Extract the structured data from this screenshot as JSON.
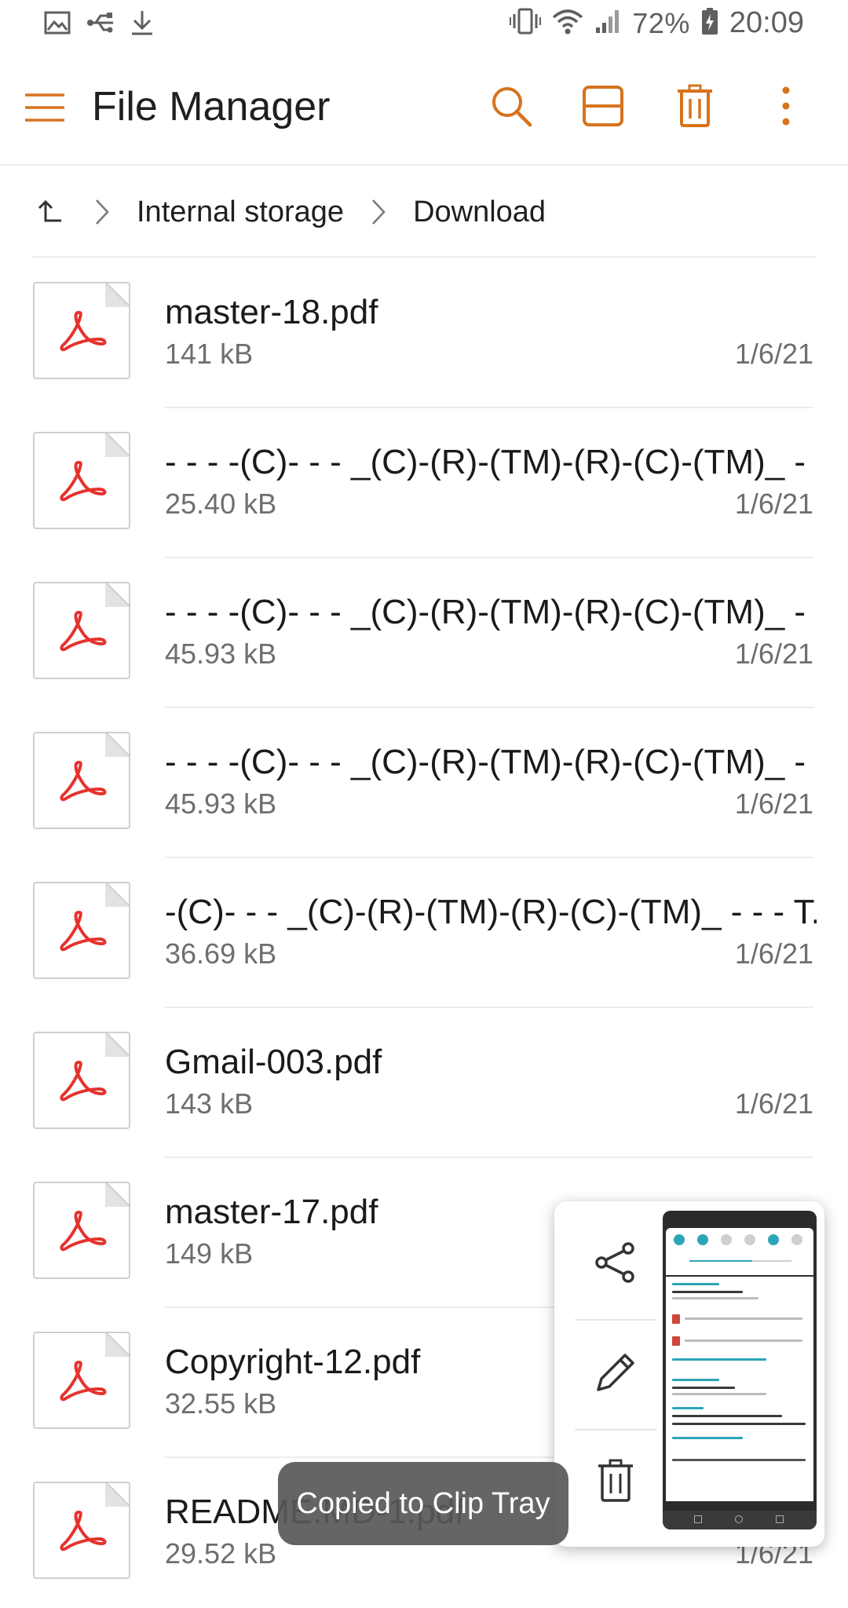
{
  "status_bar": {
    "left_icons": [
      "image-icon",
      "usb-icon",
      "download-icon"
    ],
    "right_icons": [
      "vibrate-icon",
      "wifi-icon",
      "signal-icon",
      "battery-charging-icon"
    ],
    "battery": "72%",
    "time": "20:09"
  },
  "app_bar": {
    "title": "File Manager",
    "actions": [
      "search-icon",
      "layout-icon",
      "trash-icon",
      "more-vert-icon"
    ],
    "accent_color": "#d6731d"
  },
  "breadcrumb": {
    "items": [
      "Internal storage",
      "Download"
    ]
  },
  "files": [
    {
      "name": "master-18.pdf",
      "size": "141 kB",
      "date": "1/6/21"
    },
    {
      "name": "- - - -(C)- - - _(C)-(R)-(TM)-(R)-(C)-(TM)_ - ..",
      "size": "25.40 kB",
      "date": "1/6/21"
    },
    {
      "name": "- - - -(C)- - - _(C)-(R)-(TM)-(R)-(C)-(TM)_ - ..",
      "size": "45.93 kB",
      "date": "1/6/21"
    },
    {
      "name": "- - - -(C)- - - _(C)-(R)-(TM)-(R)-(C)-(TM)_ - ..",
      "size": "45.93 kB",
      "date": "1/6/21"
    },
    {
      "name": "-(C)- - - _(C)-(R)-(TM)-(R)-(C)-(TM)_ - - - T..",
      "size": "36.69 kB",
      "date": "1/6/21"
    },
    {
      "name": "Gmail-003.pdf",
      "size": "143 kB",
      "date": "1/6/21"
    },
    {
      "name": "master-17.pdf",
      "size": "149 kB",
      "date": ""
    },
    {
      "name": "Copyright-12.pdf",
      "size": "32.55 kB",
      "date": ""
    },
    {
      "name": "README.MD-1.pdf",
      "size": "29.52 kB",
      "date": "1/6/21"
    }
  ],
  "screenshot_panel": {
    "actions": [
      "share-icon",
      "edit-icon",
      "delete-icon"
    ]
  },
  "toast": {
    "text": "Copied to Clip Tray"
  }
}
